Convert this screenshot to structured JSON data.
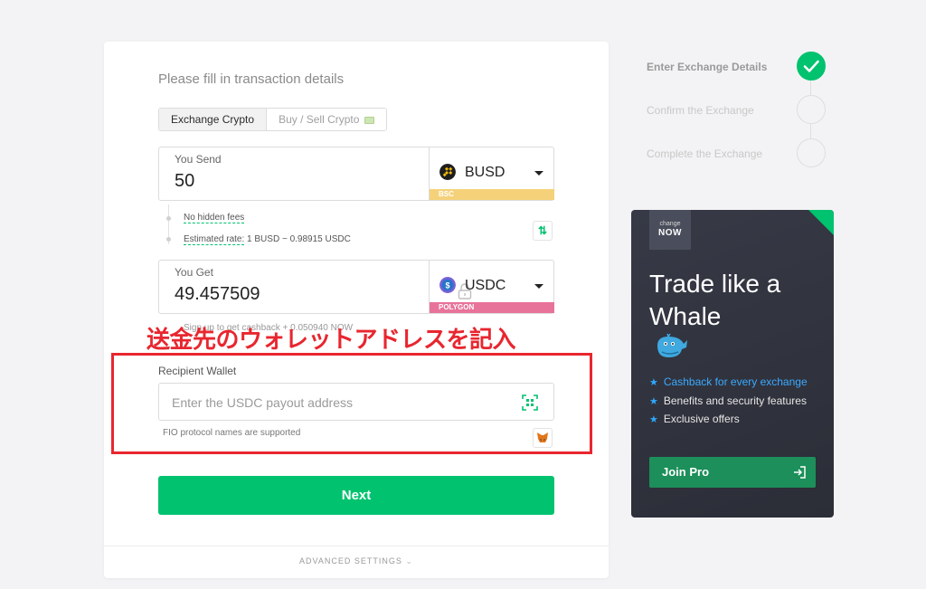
{
  "form": {
    "title": "Please fill in transaction details",
    "tabs": {
      "exchange": "Exchange Crypto",
      "buy_sell": "Buy / Sell Crypto"
    },
    "send": {
      "label": "You Send",
      "amount": "50",
      "currency": "BUSD",
      "network": "BSC",
      "network_color": "#f5d27a"
    },
    "info": {
      "no_fees": "No hidden fees",
      "rate_prefix": "Estimated rate:",
      "rate_value": "1 BUSD ~ 0.98915 USDC"
    },
    "get": {
      "label": "You Get",
      "amount": "49.457509",
      "currency": "USDC",
      "network": "POLYGON",
      "network_color": "#e8739a"
    },
    "cashback_partial": "Sign up to get cashback + 0.050940 NOW",
    "recipient": {
      "label": "Recipient Wallet",
      "placeholder": "Enter the USDC payout address",
      "fio_note": "FIO protocol names are supported"
    },
    "next_button": "Next",
    "advanced": "ADVANCED SETTINGS"
  },
  "annotation": {
    "text": "送金先のウォレットアドレスを記入",
    "color": "#e8262f"
  },
  "steps": [
    {
      "label": "Enter Exchange Details",
      "status": "done"
    },
    {
      "label": "Confirm the Exchange",
      "status": "pending"
    },
    {
      "label": "Complete the Exchange",
      "status": "pending"
    }
  ],
  "promo": {
    "logo_small": "change",
    "logo_big": "NOW",
    "title": "Trade like a Whale",
    "perks": [
      "Cashback for every exchange",
      "Benefits and security features",
      "Exclusive offers"
    ],
    "button": "Join Pro"
  },
  "colors": {
    "accent": "#00c26f",
    "promo_bg": "#2f313c",
    "annotation_red": "#e8262f"
  },
  "icons": {
    "busd": "busd-coin-icon",
    "usdc": "usdc-coin-icon",
    "swap": "swap-arrows-icon",
    "lock": "unlock-icon",
    "qr": "qr-scan-icon",
    "metamask": "metamask-fox-icon",
    "check": "check-icon",
    "whale": "whale-icon",
    "star": "star-icon",
    "login": "login-arrow-icon",
    "chevrons": "chevrons-down-icon"
  }
}
